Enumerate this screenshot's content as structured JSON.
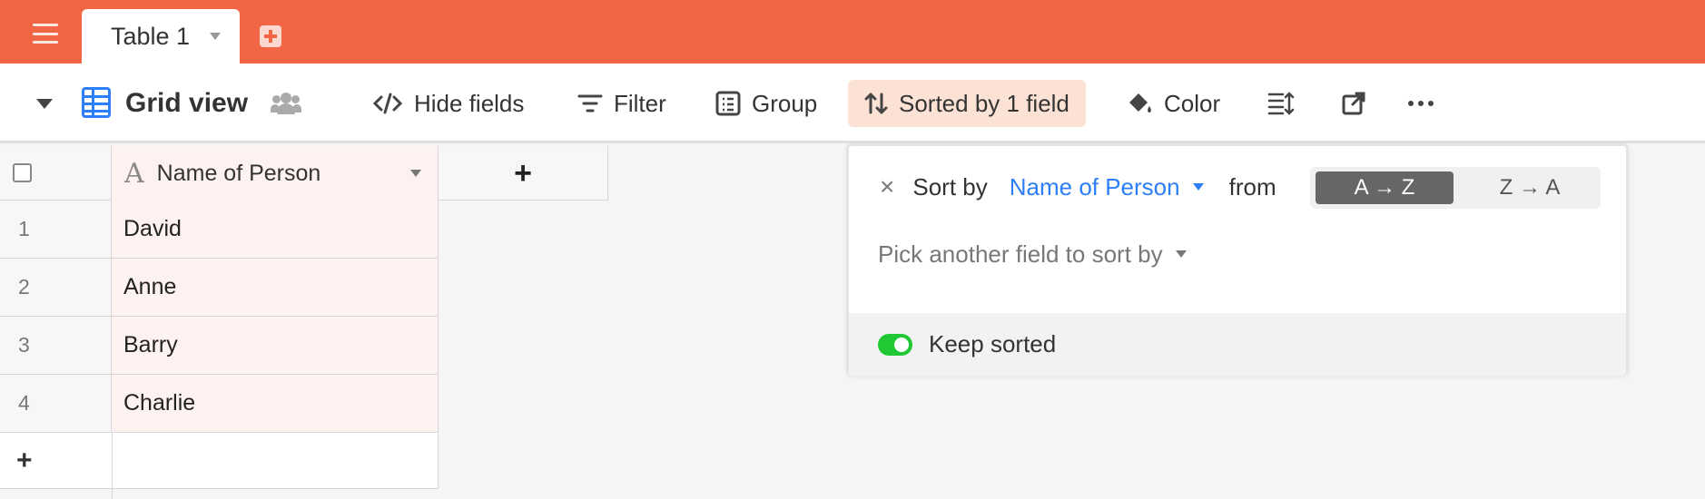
{
  "topbar": {
    "tab_label": "Table 1",
    "accent_color": "#f26645"
  },
  "toolbar": {
    "view_name": "Grid view",
    "hide_fields": "Hide fields",
    "filter": "Filter",
    "group": "Group",
    "sorted": "Sorted by 1 field",
    "color": "Color"
  },
  "grid": {
    "column_header": "Name of Person",
    "add_column": "+",
    "add_row": "+",
    "rows": [
      {
        "num": "1",
        "name": "David"
      },
      {
        "num": "2",
        "name": "Anne"
      },
      {
        "num": "3",
        "name": "Barry"
      },
      {
        "num": "4",
        "name": "Charlie"
      }
    ]
  },
  "sort_popover": {
    "remove": "×",
    "sort_by": "Sort by",
    "field": "Name of Person",
    "from": "from",
    "asc": "A → Z",
    "desc": "Z → A",
    "pick_another": "Pick another field to sort by",
    "keep_sorted": "Keep sorted",
    "keep_sorted_on": true
  }
}
